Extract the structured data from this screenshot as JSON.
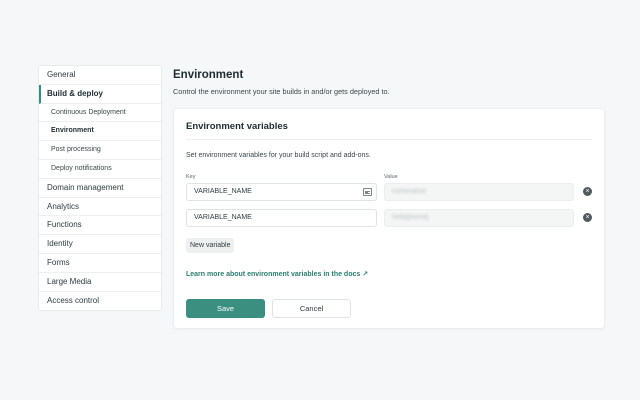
{
  "sidebar": {
    "items": [
      {
        "label": "General"
      },
      {
        "label": "Build & deploy"
      },
      {
        "label": "Continuous Deployment"
      },
      {
        "label": "Environment"
      },
      {
        "label": "Post processing"
      },
      {
        "label": "Deploy notifications"
      },
      {
        "label": "Domain management"
      },
      {
        "label": "Analytics"
      },
      {
        "label": "Functions"
      },
      {
        "label": "Identity"
      },
      {
        "label": "Forms"
      },
      {
        "label": "Large Media"
      },
      {
        "label": "Access control"
      }
    ]
  },
  "header": {
    "title": "Environment",
    "subtitle": "Control the environment your site builds in and/or gets deployed to."
  },
  "env": {
    "title": "Environment variables",
    "description": "Set environment variables for your build script and add-ons.",
    "key_label": "Key",
    "value_label": "Value",
    "rows": [
      {
        "key": "VARIABLE_NAME",
        "value": "somevalue"
      },
      {
        "key": "VARIABLE_NAME",
        "value": "hello[friend]"
      }
    ],
    "new_variable_label": "New variable",
    "docs_link": "Learn more about environment variables in the docs ↗",
    "save_label": "Save",
    "cancel_label": "Cancel"
  },
  "icons": {
    "key_field_icon": "contact-card-icon",
    "remove": "close-circle-icon"
  },
  "colors": {
    "accent": "#3a8f81",
    "link": "#2b7d70",
    "background": "#f6f7f8"
  }
}
